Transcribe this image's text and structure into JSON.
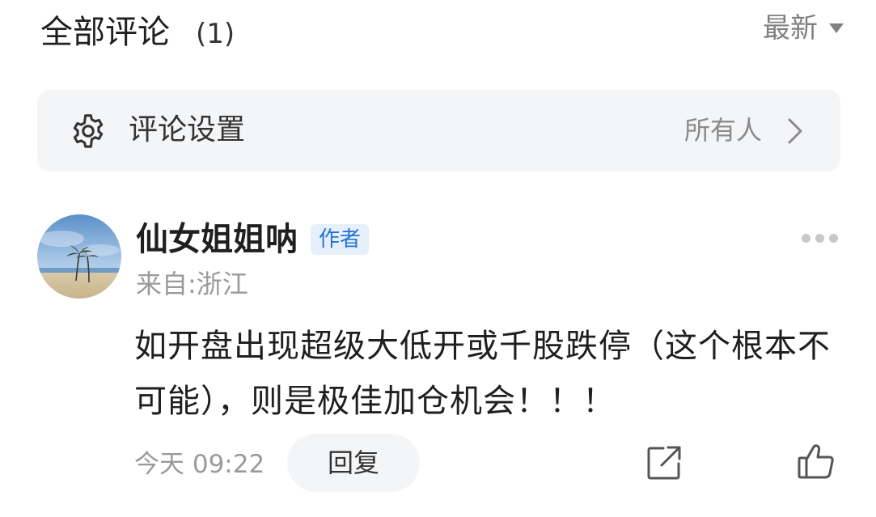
{
  "header": {
    "title": "全部评论",
    "count": "(1)",
    "sort_label": "最新",
    "sort_icon": "caret-down-icon"
  },
  "settings": {
    "icon": "gear-icon",
    "label": "评论设置",
    "value": "所有人",
    "chevron_icon": "chevron-right-icon"
  },
  "comment": {
    "avatar": "beach-palm-trees-avatar",
    "author": "仙女姐姐呐",
    "badge": "作者",
    "location": "来自:浙江",
    "text": "如开盘出现超级大低开或千股跌停（这个根本不可能），则是极佳加仓机会！！！",
    "time": "今天 09:22",
    "reply_label": "回复",
    "more_icon": "more-dots-icon",
    "share_icon": "share-icon",
    "like_icon": "thumbs-up-icon"
  },
  "colors": {
    "badge_bg": "#e6f0fb",
    "badge_text": "#2673d4",
    "muted_text": "#9a9a9a",
    "panel_bg": "#f4f5f7"
  }
}
